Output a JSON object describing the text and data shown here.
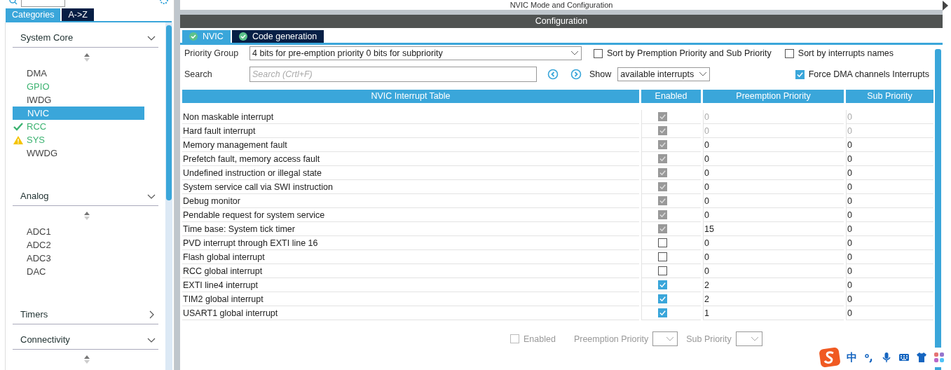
{
  "sidebar": {
    "tabs": [
      {
        "label": "Categories",
        "selected": true
      },
      {
        "label": "A->Z",
        "selected": false
      }
    ],
    "categories": [
      {
        "name": "System Core",
        "expanded": true,
        "items": [
          {
            "label": "DMA",
            "configured": false,
            "ok": false,
            "warning": false,
            "selected": false
          },
          {
            "label": "GPIO",
            "configured": true,
            "ok": false,
            "warning": false,
            "selected": false
          },
          {
            "label": "IWDG",
            "configured": false,
            "ok": false,
            "warning": false,
            "selected": false
          },
          {
            "label": "NVIC",
            "configured": false,
            "ok": false,
            "warning": false,
            "selected": true
          },
          {
            "label": "RCC",
            "configured": true,
            "ok": true,
            "warning": false,
            "selected": false
          },
          {
            "label": "SYS",
            "configured": true,
            "ok": false,
            "warning": true,
            "selected": false
          },
          {
            "label": "WWDG",
            "configured": false,
            "ok": false,
            "warning": false,
            "selected": false
          }
        ]
      },
      {
        "name": "Analog",
        "expanded": true,
        "items": [
          {
            "label": "ADC1",
            "configured": false,
            "ok": false,
            "warning": false,
            "selected": false
          },
          {
            "label": "ADC2",
            "configured": false,
            "ok": false,
            "warning": false,
            "selected": false
          },
          {
            "label": "ADC3",
            "configured": false,
            "ok": false,
            "warning": false,
            "selected": false
          },
          {
            "label": "DAC",
            "configured": false,
            "ok": false,
            "warning": false,
            "selected": false
          }
        ]
      },
      {
        "name": "Timers",
        "expanded": false
      },
      {
        "name": "Connectivity",
        "expanded": true
      }
    ]
  },
  "main": {
    "title": "NVIC Mode and Configuration",
    "section": "Configuration",
    "tabs": [
      {
        "label": "NVIC",
        "selected": true
      },
      {
        "label": "Code generation",
        "selected": false
      }
    ],
    "priority_group": {
      "label": "Priority Group",
      "value": "4 bits for pre-emption priority 0 bits for subpriority"
    },
    "sort_options": [
      {
        "label": "Sort by Premption Priority and Sub Priority",
        "checked": false
      },
      {
        "label": "Sort by interrupts names",
        "checked": false
      }
    ],
    "search": {
      "label": "Search",
      "placeholder": "Search (Crtl+F)"
    },
    "show": {
      "label": "Show",
      "value": "available interrupts"
    },
    "force_dma": {
      "label": "Force DMA channels Interrupts",
      "checked": true
    },
    "table": {
      "columns": [
        "NVIC Interrupt Table",
        "Enabled",
        "Preemption Priority",
        "Sub Priority"
      ],
      "rows": [
        {
          "name": "Non maskable interrupt",
          "enabled": true,
          "disabled": true,
          "fixed_priority": true,
          "preemption": "0",
          "sub": "0"
        },
        {
          "name": "Hard fault interrupt",
          "enabled": true,
          "disabled": true,
          "fixed_priority": true,
          "preemption": "0",
          "sub": "0"
        },
        {
          "name": "Memory management fault",
          "enabled": true,
          "disabled": true,
          "fixed_priority": false,
          "preemption": "0",
          "sub": "0"
        },
        {
          "name": "Prefetch fault, memory access fault",
          "enabled": true,
          "disabled": true,
          "fixed_priority": false,
          "preemption": "0",
          "sub": "0"
        },
        {
          "name": "Undefined instruction or illegal state",
          "enabled": true,
          "disabled": true,
          "fixed_priority": false,
          "preemption": "0",
          "sub": "0"
        },
        {
          "name": "System service call via SWI instruction",
          "enabled": true,
          "disabled": true,
          "fixed_priority": false,
          "preemption": "0",
          "sub": "0"
        },
        {
          "name": "Debug monitor",
          "enabled": true,
          "disabled": true,
          "fixed_priority": false,
          "preemption": "0",
          "sub": "0"
        },
        {
          "name": "Pendable request for system service",
          "enabled": true,
          "disabled": true,
          "fixed_priority": false,
          "preemption": "0",
          "sub": "0"
        },
        {
          "name": "Time base: System tick timer",
          "enabled": true,
          "disabled": true,
          "fixed_priority": false,
          "preemption": "15",
          "sub": "0"
        },
        {
          "name": "PVD interrupt through EXTI line 16",
          "enabled": false,
          "disabled": false,
          "fixed_priority": false,
          "preemption": "0",
          "sub": "0"
        },
        {
          "name": "Flash global interrupt",
          "enabled": false,
          "disabled": false,
          "fixed_priority": false,
          "preemption": "0",
          "sub": "0"
        },
        {
          "name": "RCC global interrupt",
          "enabled": false,
          "disabled": false,
          "fixed_priority": false,
          "preemption": "0",
          "sub": "0"
        },
        {
          "name": "EXTI line4 interrupt",
          "enabled": true,
          "disabled": false,
          "fixed_priority": false,
          "preemption": "2",
          "sub": "0"
        },
        {
          "name": "TIM2 global interrupt",
          "enabled": true,
          "disabled": false,
          "fixed_priority": false,
          "preemption": "2",
          "sub": "0"
        },
        {
          "name": "USART1 global interrupt",
          "enabled": true,
          "disabled": false,
          "fixed_priority": false,
          "preemption": "1",
          "sub": "0"
        }
      ]
    },
    "footer": {
      "enabled_label": "Enabled",
      "enabled_checked": false,
      "preemption_label": "Preemption Priority",
      "sub_label": "Sub Priority"
    }
  },
  "ime_bar": {
    "language": "中"
  }
}
